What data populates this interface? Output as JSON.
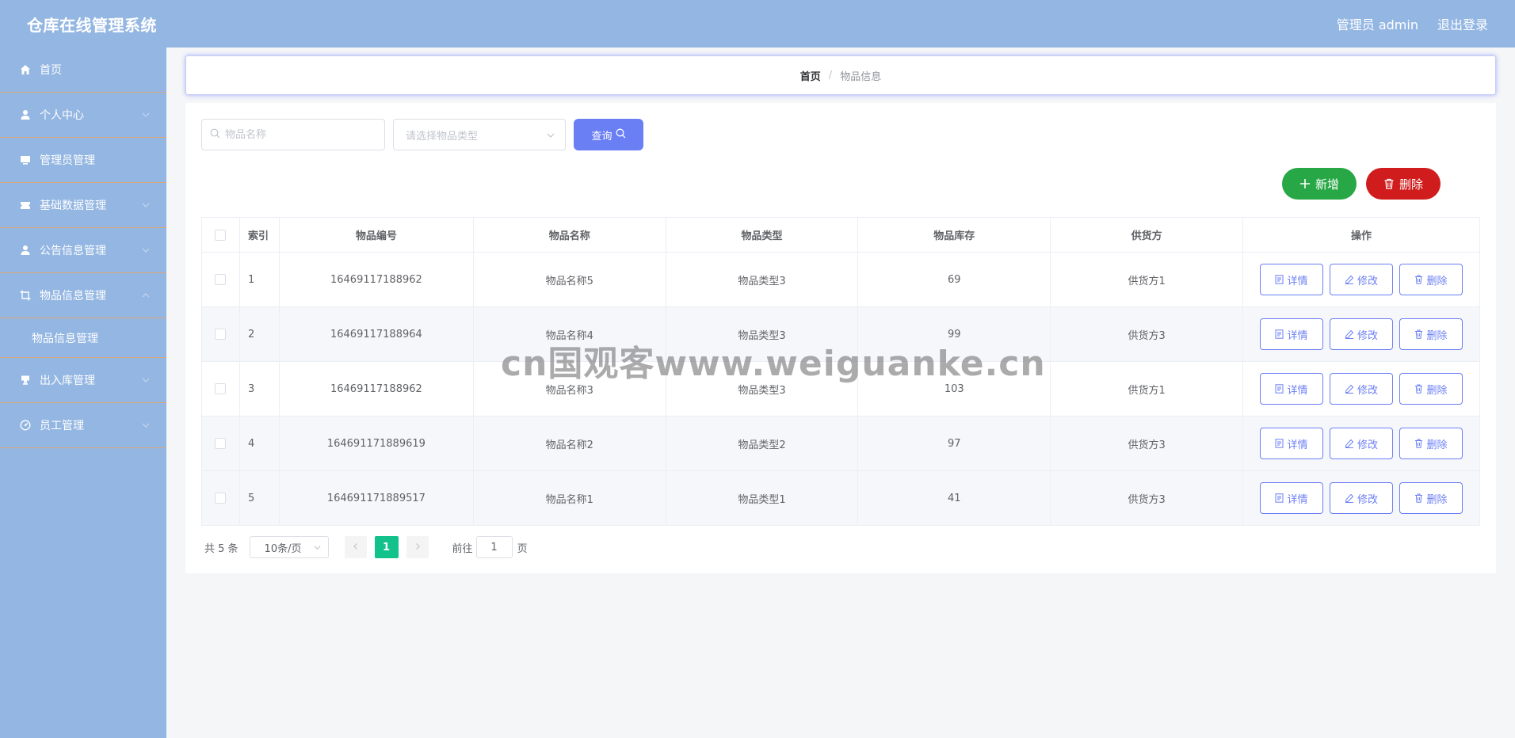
{
  "app": {
    "title": "仓库在线管理系统"
  },
  "header": {
    "user_label": "管理员 admin",
    "logout_label": "退出登录"
  },
  "sidebar": {
    "items": [
      {
        "label": "首页",
        "icon": "home-icon"
      },
      {
        "label": "个人中心",
        "icon": "user-icon"
      },
      {
        "label": "管理员管理",
        "icon": "monitor-icon"
      },
      {
        "label": "基础数据管理",
        "icon": "ticket-icon"
      },
      {
        "label": "公告信息管理",
        "icon": "user-icon"
      },
      {
        "label": "物品信息管理",
        "icon": "crop-icon"
      },
      {
        "label": "出入库管理",
        "icon": "cup-icon"
      },
      {
        "label": "员工管理",
        "icon": "odometer-icon"
      }
    ],
    "submenu": {
      "label": "物品信息管理"
    }
  },
  "breadcrumb": {
    "home": "首页",
    "separator": "/",
    "current": "物品信息"
  },
  "search": {
    "name_placeholder": "物品名称",
    "type_placeholder": "请选择物品类型",
    "query_label": "查询"
  },
  "toolbar": {
    "add_label": "新增",
    "delete_label": "删除"
  },
  "table": {
    "columns": [
      "索引",
      "物品编号",
      "物品名称",
      "物品类型",
      "物品库存",
      "供货方",
      "操作"
    ],
    "rows": [
      {
        "index": "1",
        "code": "16469117188962",
        "name": "物品名称5",
        "type": "物品类型3",
        "stock": "69",
        "supplier": "供货方1"
      },
      {
        "index": "2",
        "code": "16469117188964",
        "name": "物品名称4",
        "type": "物品类型3",
        "stock": "99",
        "supplier": "供货方3"
      },
      {
        "index": "3",
        "code": "16469117188962",
        "name": "物品名称3",
        "type": "物品类型3",
        "stock": "103",
        "supplier": "供货方1"
      },
      {
        "index": "4",
        "code": "164691171889619",
        "name": "物品名称2",
        "type": "物品类型2",
        "stock": "97",
        "supplier": "供货方3"
      },
      {
        "index": "5",
        "code": "164691171889517",
        "name": "物品名称1",
        "type": "物品类型1",
        "stock": "41",
        "supplier": "供货方3"
      }
    ],
    "actions": {
      "detail": "详情",
      "edit": "修改",
      "delete": "删除"
    }
  },
  "pagination": {
    "total_text": "共 5 条",
    "page_size": "10条/页",
    "current_page": "1",
    "goto_label": "前往",
    "goto_value": "1",
    "page_unit": "页"
  },
  "watermark": "cn国观客www.weiguanke.cn",
  "colors": {
    "header_bg": "#93b6e2",
    "primary": "#6b7ff4",
    "success": "#27a745",
    "danger": "#d01c1c",
    "page_active": "#13c28a"
  }
}
